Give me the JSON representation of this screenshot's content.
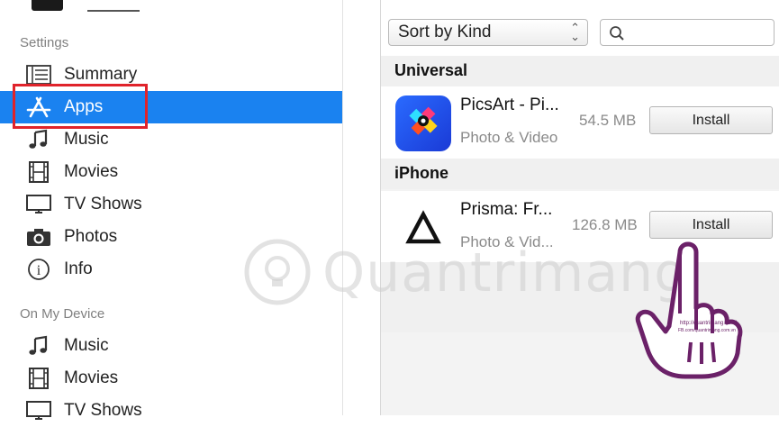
{
  "sidebar": {
    "settings_heading": "Settings",
    "settings_items": [
      {
        "label": "Summary",
        "icon": "summary-icon"
      },
      {
        "label": "Apps",
        "icon": "apps-icon",
        "selected": true
      },
      {
        "label": "Music",
        "icon": "music-note-icon"
      },
      {
        "label": "Movies",
        "icon": "film-icon"
      },
      {
        "label": "TV Shows",
        "icon": "tv-icon"
      },
      {
        "label": "Photos",
        "icon": "camera-icon"
      },
      {
        "label": "Info",
        "icon": "info-icon"
      }
    ],
    "device_heading": "On My Device",
    "device_items": [
      {
        "label": "Music",
        "icon": "music-note-icon"
      },
      {
        "label": "Movies",
        "icon": "film-icon"
      },
      {
        "label": "TV Shows",
        "icon": "tv-icon"
      }
    ]
  },
  "toolbar": {
    "sort_value": "Sort by Kind",
    "search_value": "",
    "search_placeholder": ""
  },
  "groups": [
    {
      "title": "Universal",
      "apps": [
        {
          "name": "PicsArt - Pi...",
          "category": "Photo & Video",
          "size": "54.5 MB",
          "button": "Install"
        }
      ]
    },
    {
      "title": "iPhone",
      "apps": [
        {
          "name": "Prisma: Fr...",
          "category": "Photo & Vid...",
          "size": "126.8 MB",
          "button": "Install"
        }
      ]
    }
  ],
  "watermark": {
    "text": "Quantrimang",
    "hand_caption_1": "http://quantrimang.com/",
    "hand_caption_2": "FB.com/quantrimang.com.vn"
  },
  "colors": {
    "selected": "#1a82f0",
    "highlight": "#e0232b",
    "hand": "#6b2168"
  }
}
